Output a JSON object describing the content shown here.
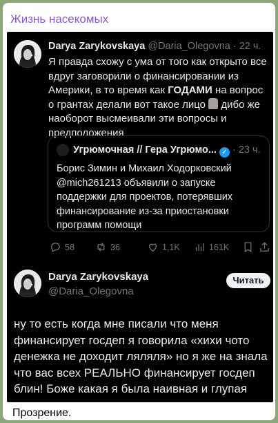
{
  "channel": {
    "name": "Жизнь насекомых"
  },
  "tweet1": {
    "author_name": "Darya Zarykovskaya",
    "handle": "@Daria_Olegovna",
    "time": "· 22 ч.",
    "text_part1": "Я правда схожу с ума от того как открыто все вдруг заговорили о финансировании из Америки, в то время как ",
    "text_bold": "ГОДАМИ",
    "text_part2": " на вопрос о грантах делали вот такое лицо ",
    "emoji": "moai-emoji",
    "text_part3": " дибо же наоборот высмеивали эти вопросы и предположения",
    "avatar_icon": "profile-photo"
  },
  "quote": {
    "author_name": "Угрюмочная // Гера Угрюмо...",
    "time": "· 23 ч.",
    "verified_icon": "verified-badge-icon",
    "text": "Борис Зимин и Михаил Ходорковский @mich261213 объявили о запуске поддержки для проектов, потерявших финансирование из-за приостановки программ помощи"
  },
  "actions": {
    "replies": "58",
    "retweets": "36",
    "likes": "1,1K",
    "views": "161K"
  },
  "tweet2": {
    "author_name": "Darya Zarykovskaya",
    "handle": "@Daria_Olegovna",
    "read_button": "Читать",
    "text": "ну то есть когда мне писали что меня финансирует госдеп я говорила «хихи чото денежка не доходит ляляля» но я же на знала что вас всех РЕАЛЬНО финансирует госдеп блин! Боже какая я была наивная и глупая"
  },
  "caption": "Прозрение.",
  "colors": {
    "background": "#8ba77a",
    "channel_name": "#8b5cc7",
    "tweet_bg": "#000000",
    "muted": "#71767b",
    "verified": "#1d9bf0"
  }
}
